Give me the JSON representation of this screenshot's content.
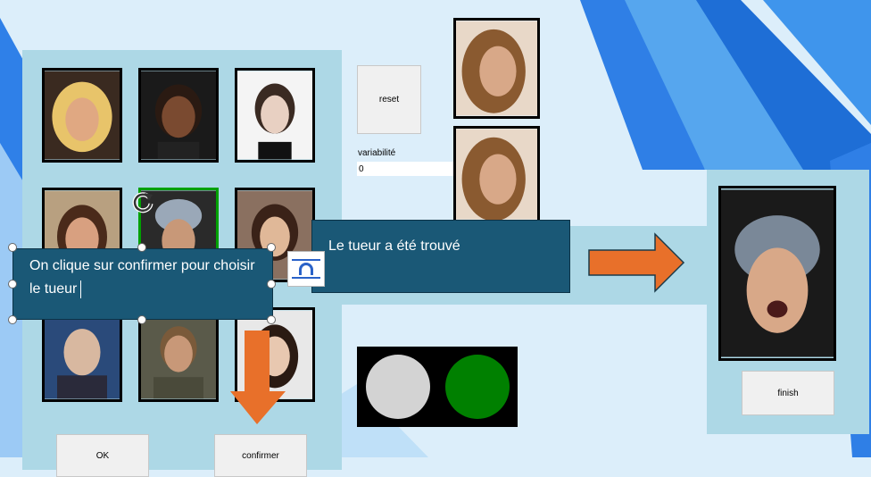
{
  "panel": {
    "reset_label": "reset",
    "variability_label": "variabilité",
    "variability_value": "0",
    "ok_label": "OK",
    "confirm_label": "confirmer",
    "finish_label": "finish"
  },
  "callouts": {
    "left_text": "On clique sur confirmer pour choisir le tueur",
    "right_text": "Le tueur a été trouvé"
  },
  "indicators": {
    "off_color": "#d3d3d3",
    "on_color": "#008000"
  },
  "icons": [
    "rotate-handle-icon",
    "layout-options-icon",
    "arrow-right",
    "arrow-down"
  ],
  "colors": {
    "callout": "#1a5876",
    "arrow": "#e8702a",
    "panel": "#add8e6",
    "selected_border": "#00a000"
  }
}
